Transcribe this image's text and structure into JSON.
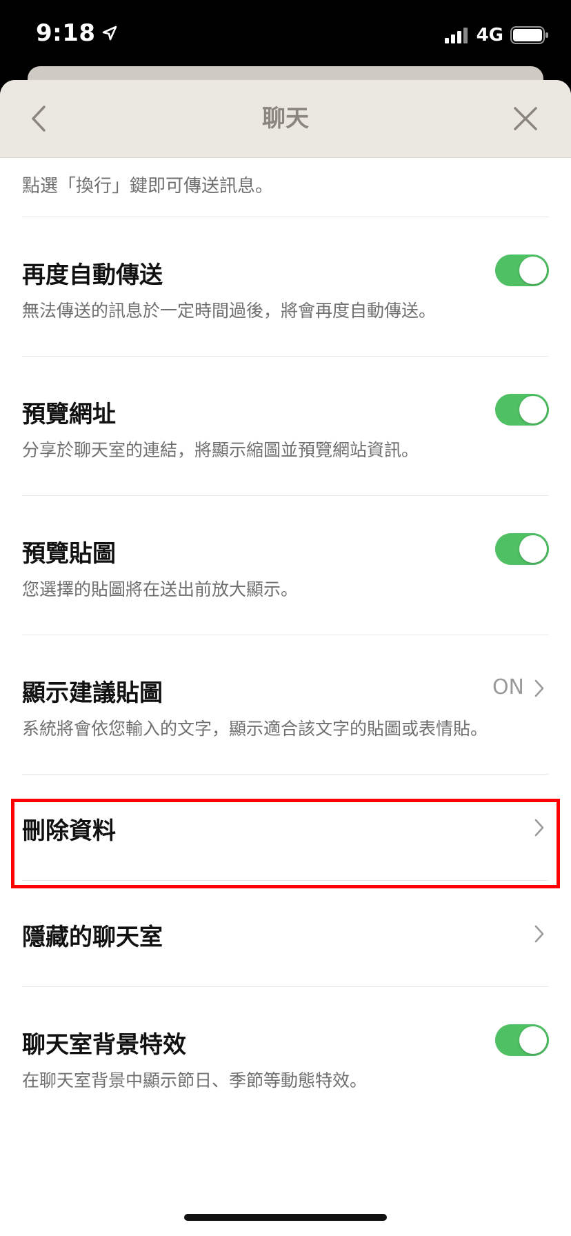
{
  "status_bar": {
    "time": "9:18",
    "network": "4G"
  },
  "header": {
    "title": "聊天"
  },
  "top_description": "點選「換行」鍵即可傳送訊息。",
  "settings": [
    {
      "title": "再度自動傳送",
      "description": "無法傳送的訊息於一定時間過後，將會再度自動傳送。",
      "control": "toggle",
      "state": "on"
    },
    {
      "title": "預覽網址",
      "description": "分享於聊天室的連結，將顯示縮圖並預覽網站資訊。",
      "control": "toggle",
      "state": "on"
    },
    {
      "title": "預覽貼圖",
      "description": "您選擇的貼圖將在送出前放大顯示。",
      "control": "toggle",
      "state": "on"
    },
    {
      "title": "顯示建議貼圖",
      "description": "系統將會依您輸入的文字，顯示適合該文字的貼圖或表情貼。",
      "control": "link",
      "value": "ON"
    },
    {
      "title": "刪除資料",
      "control": "link"
    },
    {
      "title": "隱藏的聊天室",
      "control": "link"
    },
    {
      "title": "聊天室背景特效",
      "description": "在聊天室背景中顯示節日、季節等動態特效。",
      "control": "toggle",
      "state": "on"
    }
  ],
  "colors": {
    "toggle_on": "#4fc063",
    "header_bg": "#ebe7e1",
    "highlight": "#ff0000"
  }
}
